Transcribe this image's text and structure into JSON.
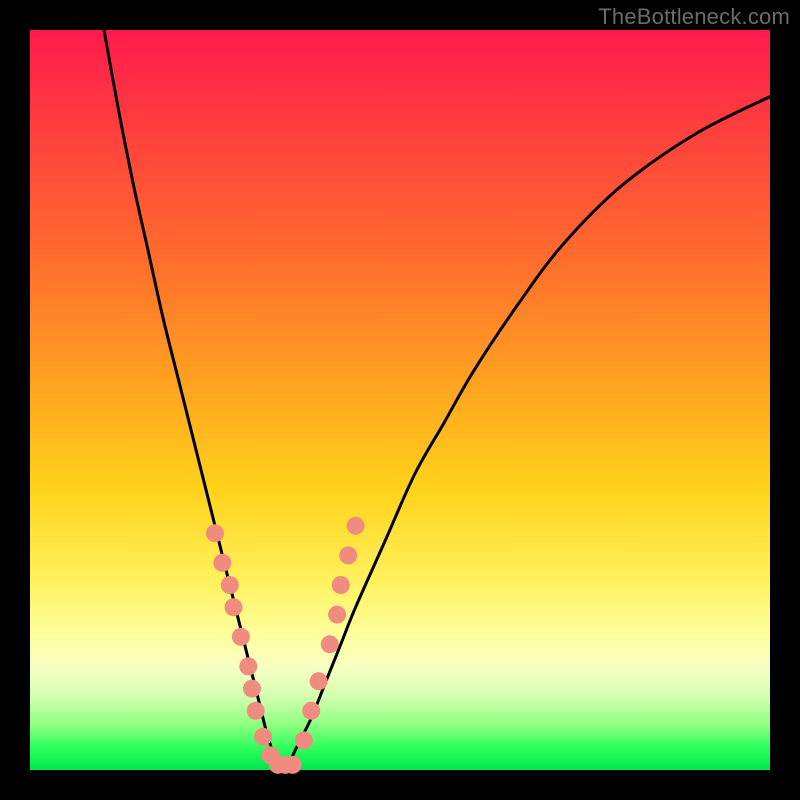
{
  "watermark": "TheBottleneck.com",
  "chart_data": {
    "type": "line",
    "title": "",
    "xlabel": "",
    "ylabel": "",
    "xlim": [
      0,
      100
    ],
    "ylim": [
      0,
      100
    ],
    "grid": false,
    "legend": false,
    "series": [
      {
        "name": "v-curve",
        "color": "#000000",
        "x": [
          10,
          12,
          14,
          16,
          18,
          20,
          22,
          24,
          26,
          28,
          29,
          30,
          31,
          32,
          33,
          34,
          35,
          36,
          38,
          40,
          42,
          44,
          48,
          52,
          56,
          60,
          66,
          72,
          80,
          90,
          100
        ],
        "y": [
          100,
          89,
          79,
          70,
          61,
          53,
          45,
          37,
          29,
          21,
          17,
          13,
          9,
          5,
          2,
          0.5,
          1,
          3,
          7,
          12,
          17,
          22,
          31,
          40,
          47,
          54,
          63,
          71,
          79,
          86,
          91
        ]
      }
    ],
    "markers": {
      "name": "salmon-dots",
      "color": "#ef8b7f",
      "radius_px": 9,
      "points": [
        {
          "x": 25.0,
          "y": 32
        },
        {
          "x": 26.0,
          "y": 28
        },
        {
          "x": 27.0,
          "y": 25
        },
        {
          "x": 27.5,
          "y": 22
        },
        {
          "x": 28.5,
          "y": 18
        },
        {
          "x": 29.5,
          "y": 14
        },
        {
          "x": 30.0,
          "y": 11
        },
        {
          "x": 30.5,
          "y": 8
        },
        {
          "x": 31.5,
          "y": 4.5
        },
        {
          "x": 32.5,
          "y": 2
        },
        {
          "x": 33.5,
          "y": 0.7
        },
        {
          "x": 34.5,
          "y": 0.7
        },
        {
          "x": 35.5,
          "y": 0.7
        },
        {
          "x": 37.0,
          "y": 4
        },
        {
          "x": 38.0,
          "y": 8
        },
        {
          "x": 39.0,
          "y": 12
        },
        {
          "x": 40.5,
          "y": 17
        },
        {
          "x": 41.5,
          "y": 21
        },
        {
          "x": 42.0,
          "y": 25
        },
        {
          "x": 43.0,
          "y": 29
        },
        {
          "x": 44.0,
          "y": 33
        }
      ]
    }
  }
}
